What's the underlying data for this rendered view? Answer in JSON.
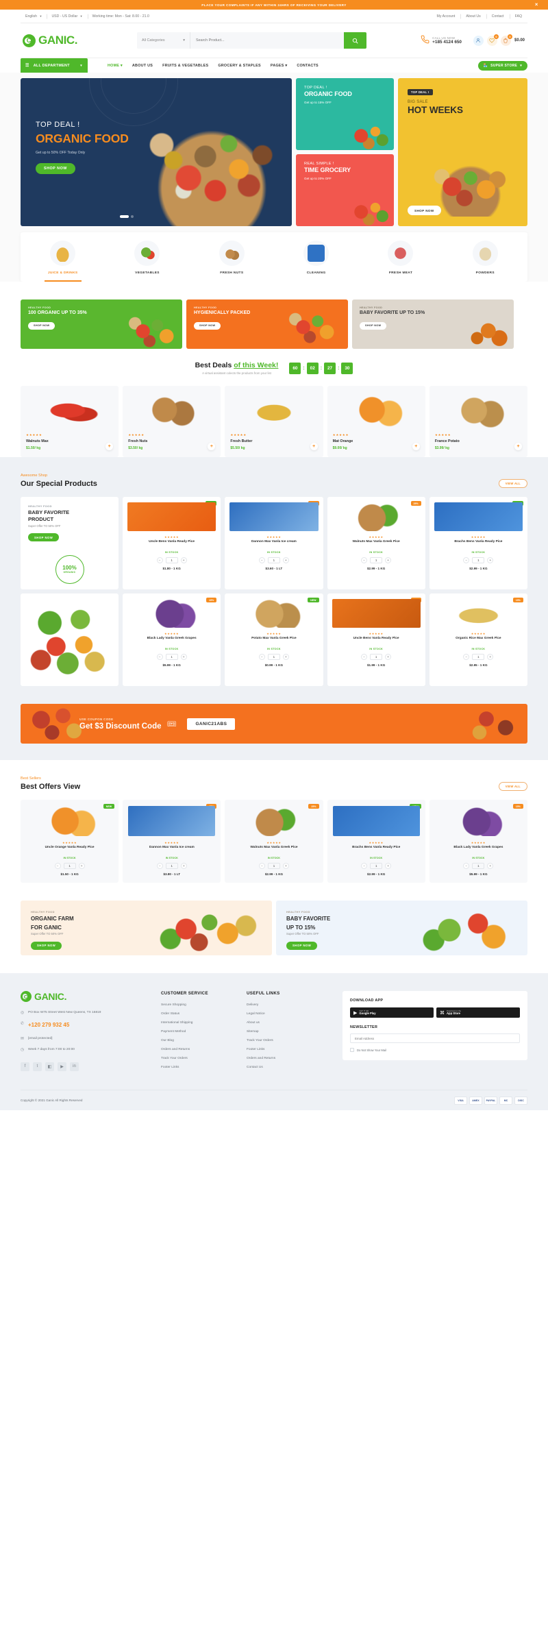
{
  "announce": {
    "text": "PLACE YOUR COMPLAINTS IF ANY WITHIN 24HRS OF RECEIVING YOUR DELIVERY",
    "close_icon": "close-icon"
  },
  "topbar": {
    "language": "English",
    "currency": "USD - US Dollar",
    "working_time": "Working time: Mon - Sat: 8.00 - 21.0",
    "links": [
      "My Account",
      "About Us",
      "Contact",
      "FAQ"
    ]
  },
  "header": {
    "logo_letter": "C",
    "logo_text": "GANIC.",
    "search": {
      "category": "All Categories",
      "placeholder": "Search Product...",
      "value": "",
      "button_icon": "search-icon"
    },
    "call": {
      "label": "CALL US NOW",
      "number": "+185 4124 650"
    },
    "account_icon": "user-icon",
    "wishlist_icon": "heart-icon",
    "wishlist_count": "0",
    "cart_icon": "bag-icon",
    "cart_count": "0",
    "cart_total": "$0.00"
  },
  "nav": {
    "all_department": "ALL DEPARTMENT",
    "menu": [
      {
        "label": "HOME",
        "active": true,
        "caret": true
      },
      {
        "label": "ABOUT US",
        "active": false,
        "caret": false
      },
      {
        "label": "FRUITS & VEGETABLES",
        "active": false,
        "caret": false
      },
      {
        "label": "GROCERY & STAPLES",
        "active": false,
        "caret": false
      },
      {
        "label": "PAGES",
        "active": false,
        "caret": true
      },
      {
        "label": "CONTACTS",
        "active": false,
        "caret": false
      }
    ],
    "super_store": "SUPER STORE"
  },
  "hero": {
    "main": {
      "eyebrow": "TOP DEAL !",
      "title": "ORGANIC FOOD",
      "subtitle": "Get up to 50% OFF Today Only",
      "button": "SHOP NOW"
    },
    "teal": {
      "tag": "TOP DEAL !",
      "title": "ORGANIC FOOD",
      "desc": "Get up to 15% OFF"
    },
    "red": {
      "tag": "REAL SIMPLE !",
      "title": "TIME GROCERY",
      "desc": "Get up to 20% OFF"
    },
    "yellow": {
      "tag": "TOP DEAL !",
      "sub": "BIG SALE",
      "title": "HOT WEEKS",
      "button": "SHOP NOW"
    }
  },
  "categories": [
    {
      "label": "JUICE & DRINKS",
      "icon": "juice-jar-icon",
      "active": true
    },
    {
      "label": "VEGETABLES",
      "icon": "vegetables-icon",
      "active": false
    },
    {
      "label": "FRESH NUTS",
      "icon": "nuts-icon",
      "active": false
    },
    {
      "label": "CLEANING",
      "icon": "cleaning-icon",
      "active": false
    },
    {
      "label": "FRESH MEAT",
      "icon": "meat-icon",
      "active": false
    },
    {
      "label": "POWDERS",
      "icon": "powder-icon",
      "active": false
    }
  ],
  "promos": [
    {
      "tag": "HEALTHY FOOD",
      "title": "100 ORGANIC UP TO 35%",
      "button": "SHOP NOW"
    },
    {
      "tag": "HEALTHY FOOD",
      "title": "HYGIENICALLY PACKED",
      "button": "SHOP NOW"
    },
    {
      "tag": "HEALTHY FOOD",
      "title": "BABY FAVORITE UP TO 15%",
      "button": "SHOP NOW"
    }
  ],
  "deals": {
    "title_a": "Best Deals",
    "title_b": "of this Week!",
    "subtitle": "A virtual assistant colects the products from your list",
    "countdown": [
      "60",
      "02",
      "27",
      "30"
    ],
    "products": [
      {
        "name": "Walnuts Max",
        "price": "$1.50/ kg",
        "stars": "★★★★★",
        "icon": "chili-image"
      },
      {
        "name": "Fresh Nuts",
        "price": "$3.50/ kg",
        "stars": "★★★★★",
        "icon": "walnuts-image"
      },
      {
        "name": "Fresh Butter",
        "price": "$5.50/ kg",
        "stars": "★★★★★",
        "icon": "butter-jar-image"
      },
      {
        "name": "Mat Orange",
        "price": "$9.00/ kg",
        "stars": "★★★★★",
        "icon": "orange-image"
      },
      {
        "name": "France Potato",
        "price": "$3.99/ kg",
        "stars": "★★★★★",
        "icon": "potato-image"
      }
    ]
  },
  "special": {
    "eyebrow": "Awesome Shop",
    "title": "Our Special Products",
    "view_all": "VIEW ALL",
    "feature": {
      "tag": "HEALTHY FOOD",
      "t1": "BABY FAVORITE",
      "t2": "PRODUCT",
      "sub": "Super Offer TO 50% OFF",
      "button": "SHOP NOW",
      "seal_number": "100%",
      "seal_text": "ORGANIC"
    },
    "products": [
      {
        "name": "Uncle Bens Vanla Ready Pice",
        "price": "$1.80 - 1 KG",
        "stock": "IN STOCK",
        "stars": "★★★★★",
        "qty": "1",
        "badge": "NEW",
        "badge_type": "new"
      },
      {
        "name": "Dannon Max Vanla Ice cream",
        "price": "$3.60 - 1 LT",
        "stock": "IN STOCK",
        "stars": "★★★★★",
        "qty": "1",
        "badge": "15%",
        "badge_type": "off"
      },
      {
        "name": "Walnuts Max Vanla Greek Pice",
        "price": "$2.99 - 1 KG",
        "stock": "IN STOCK",
        "stars": "★★★★★",
        "qty": "1",
        "badge": "25%",
        "badge_type": "off"
      },
      {
        "name": "Brachs Bens Vanla Ready Pice",
        "price": "$2.99 - 1 KG",
        "stock": "IN STOCK",
        "stars": "★★★★★",
        "qty": "1",
        "badge": "NEW",
        "badge_type": "new"
      },
      {
        "name": "Black Lady Vanla Greek Grapes",
        "price": "$5.99 - 1 KG",
        "stock": "IN STOCK",
        "stars": "★★★★★",
        "qty": "1",
        "badge": "15%",
        "badge_type": "off"
      },
      {
        "name": "Potato Max Vanla Greek Pice",
        "price": "$0.99 - 1 KG",
        "stock": "IN STOCK",
        "stars": "★★★★★",
        "qty": "1",
        "badge": "NEW",
        "badge_type": "new"
      },
      {
        "name": "Uncle Bens Vanla Ready Pice",
        "price": "$1.99 - 1 KG",
        "stock": "IN STOCK",
        "stars": "★★★★★",
        "qty": "1",
        "badge": "15%",
        "badge_type": "off"
      },
      {
        "name": "Organic Rice Max Greek Pice",
        "price": "$2.95 - 1 KG",
        "stock": "IN STOCK",
        "stars": "★★★★★",
        "qty": "1",
        "badge": "15%",
        "badge_type": "off"
      }
    ]
  },
  "coupon": {
    "eyebrow": "USE COUPON CODE",
    "title": "Get $3 Discount Code",
    "code": "GANIC21ABS",
    "ticket_icon": "ticket-icon"
  },
  "best": {
    "eyebrow": "Best Sellers",
    "title": "Best Offers View",
    "view_all": "VIEW ALL",
    "products": [
      {
        "name": "Uncle Orange Vanla Ready Pice",
        "price": "$1.50 - 1 KG",
        "stock": "IN STOCK",
        "stars": "★★★★★",
        "qty": "1",
        "badge": "NEW",
        "badge_type": "new"
      },
      {
        "name": "Dannon Max Vanla Ice cream",
        "price": "$3.80 - 1 LT",
        "stock": "IN STOCK",
        "stars": "★★★★★",
        "qty": "1",
        "badge": "15%",
        "badge_type": "off"
      },
      {
        "name": "Walnuts Max Vanla Greek Pice",
        "price": "$2.99 - 1 KG",
        "stock": "IN STOCK",
        "stars": "★★★★★",
        "qty": "1",
        "badge": "25%",
        "badge_type": "off"
      },
      {
        "name": "Brachs Bens Vanla Ready Pice",
        "price": "$2.99 - 1 KG",
        "stock": "IN STOCK",
        "stars": "★★★★★",
        "qty": "1",
        "badge": "NEW",
        "badge_type": "new"
      },
      {
        "name": "Black Lady Vanla Greek Grapes",
        "price": "$5.99 - 1 KG",
        "stock": "IN STOCK",
        "stars": "★★★★★",
        "qty": "1",
        "badge": "15%",
        "badge_type": "off"
      }
    ]
  },
  "bottom_banners": [
    {
      "tag": "HEALTHY FOOD",
      "t1": "ORGANIC FARM",
      "t2": "FOR GANIC",
      "sub": "Super Offer TO 50% OFF",
      "button": "SHOP NOW"
    },
    {
      "tag": "HEALTHY FOOD",
      "t1": "BABY FAVORITE",
      "t2": "UP TO 15%",
      "sub": "Super Offer TO 50% OFF",
      "button": "SHOP NOW"
    }
  ],
  "footer": {
    "logo_letter": "C",
    "logo_text": "GANIC.",
    "address": "PO Box W75 Street West New Queens, TX 16819",
    "phone": "+120 279 932 45",
    "email": "[email protected]",
    "hours": "Week 7 days from 7:00 to 20:00",
    "social": [
      "facebook-icon",
      "twitter-icon",
      "instagram-icon",
      "youtube-icon",
      "linkedin-icon"
    ],
    "customer_service": {
      "heading": "CUSTOMER SERVICE",
      "links": [
        "Secure Shopping",
        "Order Status",
        "International Shipping",
        "Payment Method",
        "Our Blog",
        "Orders and Returns",
        "Track Your Orders",
        "Footer Links"
      ]
    },
    "useful_links": {
      "heading": "USEFUL LINKS",
      "links": [
        "Delivery",
        "Legal Notice",
        "About us",
        "Sitemap",
        "Track Your Orders",
        "Footer Links",
        "Orders and Returns",
        "Contact Us"
      ]
    },
    "app": {
      "heading": "DOWNLOAD APP",
      "google": {
        "small": "GET IT ON",
        "big": "Google Play",
        "icon": "google-play-icon"
      },
      "apple": {
        "small": "Download on the",
        "big": "App Store",
        "icon": "apple-icon"
      }
    },
    "newsletter": {
      "heading": "NEWSLETTER",
      "placeholder": "Email Address",
      "value": "",
      "checkbox_label": "Do Not Show Your Mail"
    },
    "copyright": "Copyright © 2021 Ganic All Rights Reserved",
    "cards": [
      "VISA",
      "AMEX",
      "PAYPAL",
      "MC",
      "DISC"
    ]
  }
}
